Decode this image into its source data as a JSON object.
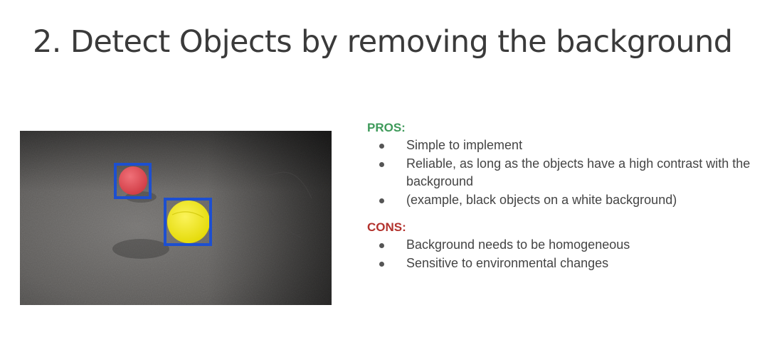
{
  "slide": {
    "title": "2. Detect Objects by removing the background"
  },
  "pros": {
    "heading": "PROS:",
    "color": "#3e9a5a",
    "items": [
      "Simple to implement",
      "Reliable, as long as the objects have a high contrast with the background",
      "(example, black objects on a white background)"
    ]
  },
  "cons": {
    "heading": "CONS:",
    "color": "#b3322d",
    "items": [
      "Background needs to be homogeneous",
      "Sensitive to environmental changes"
    ]
  },
  "image": {
    "objects": [
      {
        "name": "red-ball",
        "color": "#e0464d"
      },
      {
        "name": "yellow-ball",
        "color": "#f2ea0c"
      }
    ],
    "box_color": "#1d4fd0"
  }
}
